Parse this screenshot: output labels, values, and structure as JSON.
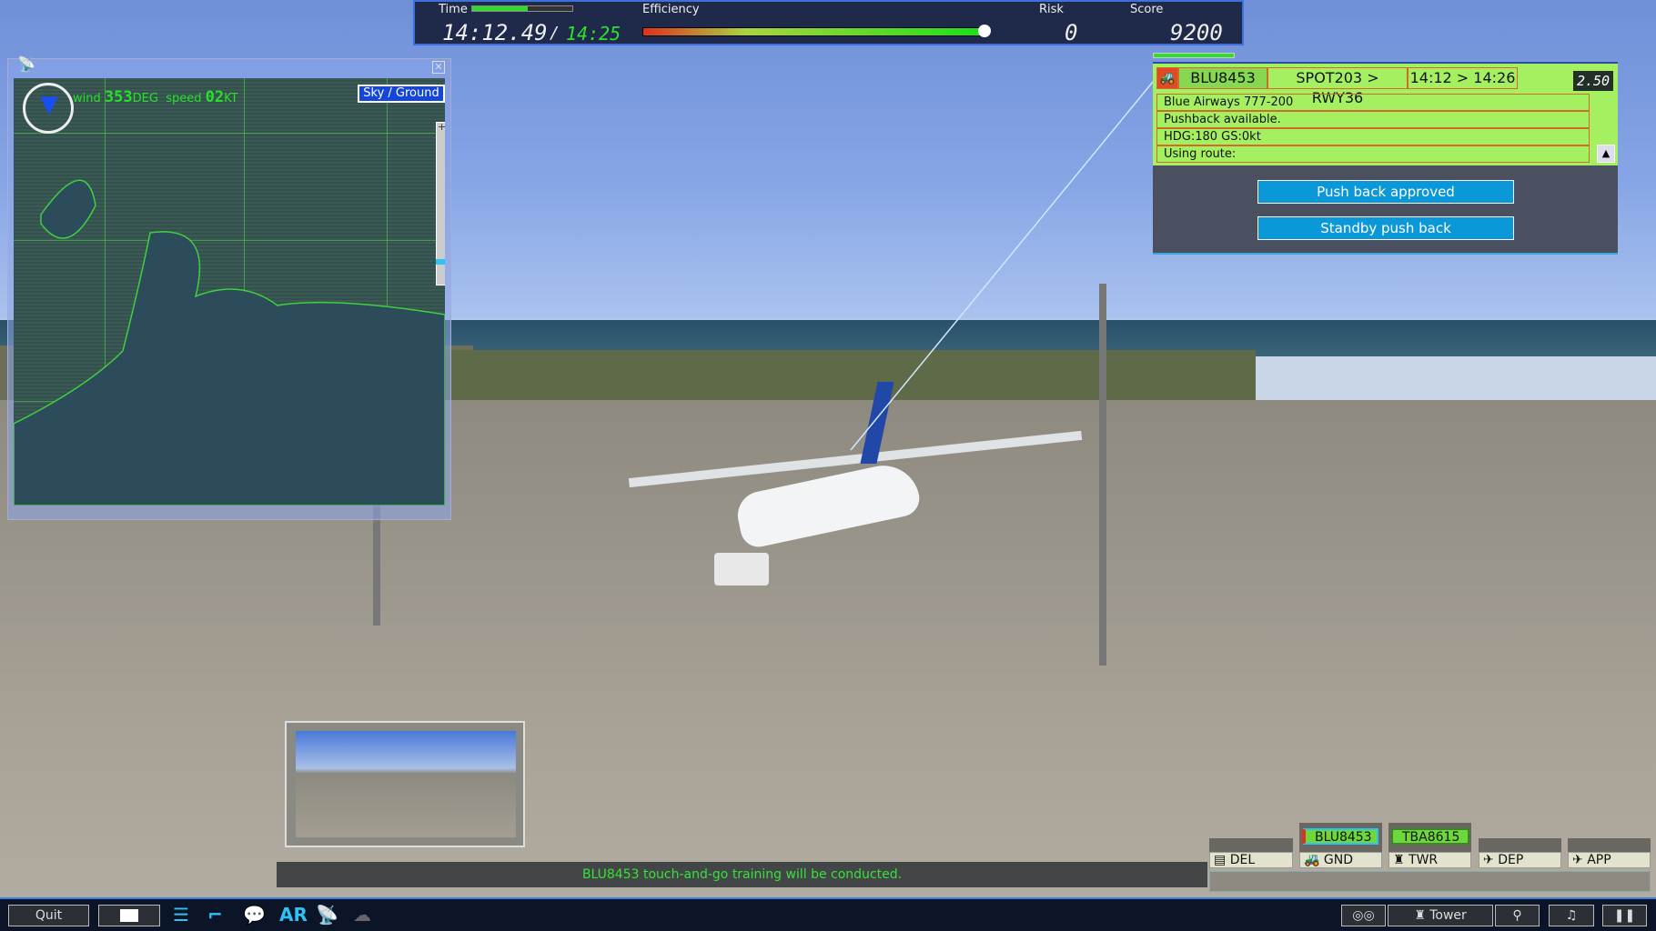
{
  "colors": {
    "accent": "#2ec2f2",
    "strip_green": "#a4f060",
    "button_blue": "#0a98d8",
    "message_green": "#3ae03a"
  },
  "topbar": {
    "time_label": "Time",
    "time_current": "14:12.49",
    "time_separator": "/",
    "time_target": "14:25",
    "time_progress": 0.55,
    "efficiency_label": "Efficiency",
    "efficiency_level": 0.99,
    "risk_label": "Risk",
    "risk_value": "0",
    "score_label": "Score",
    "score_value": "9200"
  },
  "map": {
    "wind_label": "wind",
    "wind_deg": "353",
    "wind_deg_unit": "DEG",
    "speed_label": "speed",
    "speed_value": "02",
    "speed_unit": "KT",
    "sky_ground_button": "Sky / Ground",
    "zoom_plus": "+",
    "close_icon": "close-icon"
  },
  "strip": {
    "vehicle_icon": "tug-icon",
    "callsign": "BLU8453",
    "route": "SPOT203 > RWY36",
    "times": "14:12 > 14:26",
    "timer": "2.50",
    "lines": [
      "Blue Airways 777-200",
      "Pushback available.",
      "HDG:180 GS:0kt",
      "Using route:"
    ],
    "collapse_icon": "▲",
    "buttons": [
      "Push back approved",
      "Standby push back"
    ]
  },
  "message": "BLU8453 touch-and-go training will be conducted.",
  "frequencies": [
    {
      "label": "DEL",
      "icon": "document-icon",
      "glyph": "▤",
      "chips": []
    },
    {
      "label": "GND",
      "icon": "tug-icon",
      "glyph": "🚜",
      "chips": [
        "BLU8453"
      ]
    },
    {
      "label": "TWR",
      "icon": "tower-icon",
      "glyph": "♜",
      "chips": [
        "TBA8615"
      ]
    },
    {
      "label": "DEP",
      "icon": "departure-icon",
      "glyph": "✈",
      "chips": []
    },
    {
      "label": "APP",
      "icon": "arrival-icon",
      "glyph": "✈",
      "chips": []
    }
  ],
  "toolbar": {
    "quit": "Quit",
    "ar": "AR",
    "tower": "Tower",
    "music_glyph": "♫",
    "pause_glyph": "❚❚",
    "search_glyph": "⚲",
    "binoculars_glyph": "◎◎"
  }
}
